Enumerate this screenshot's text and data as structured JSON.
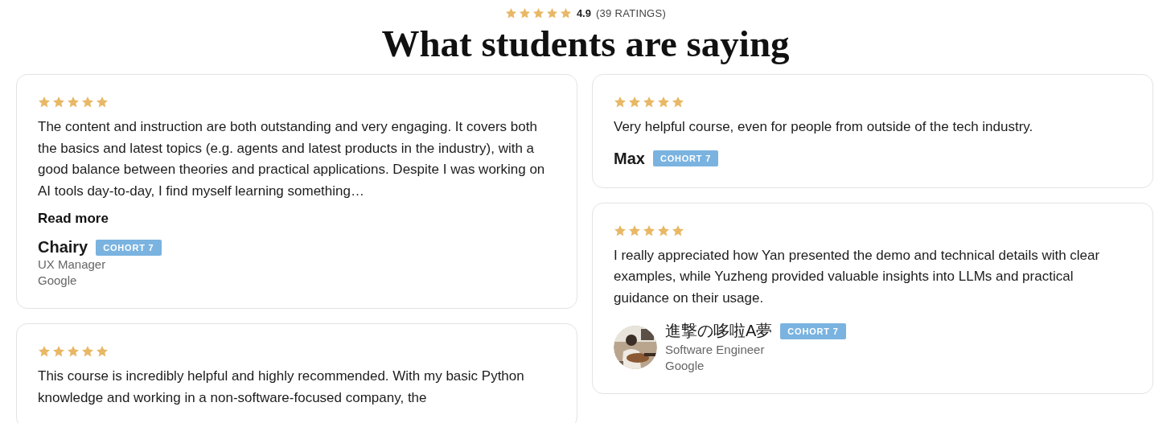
{
  "rating": {
    "stars": 5,
    "score": "4.9",
    "count": "(39 RATINGS)"
  },
  "title": "What students are saying",
  "columns": [
    {
      "reviews": [
        {
          "stars": 5,
          "text": "The content and instruction are both outstanding and very engaging. It covers both the basics and latest topics (e.g. agents and latest products in the industry), with a good balance between theories and practical applications. Despite I was working on AI tools day-to-day, I find myself learning something…",
          "read_more": "Read more",
          "name": "Chairy",
          "cohort": "COHORT 7",
          "role": "UX Manager",
          "company": "Google"
        },
        {
          "stars": 5,
          "text": "This course is incredibly helpful and highly recommended. With my basic Python knowledge and working in a non-software-focused company, the"
        }
      ]
    },
    {
      "reviews": [
        {
          "stars": 5,
          "text": "Very helpful course, even for people from outside of the tech industry.",
          "name": "Max",
          "cohort": "COHORT 7"
        },
        {
          "stars": 5,
          "text": "I really appreciated how Yan presented the demo and technical details with clear examples, while Yuzheng provided valuable insights into LLMs and practical guidance on their usage.",
          "name": "進撃の哆啦A夢",
          "cohort": "COHORT 7",
          "role": "Software Engineer",
          "company": "Google"
        }
      ]
    }
  ]
}
